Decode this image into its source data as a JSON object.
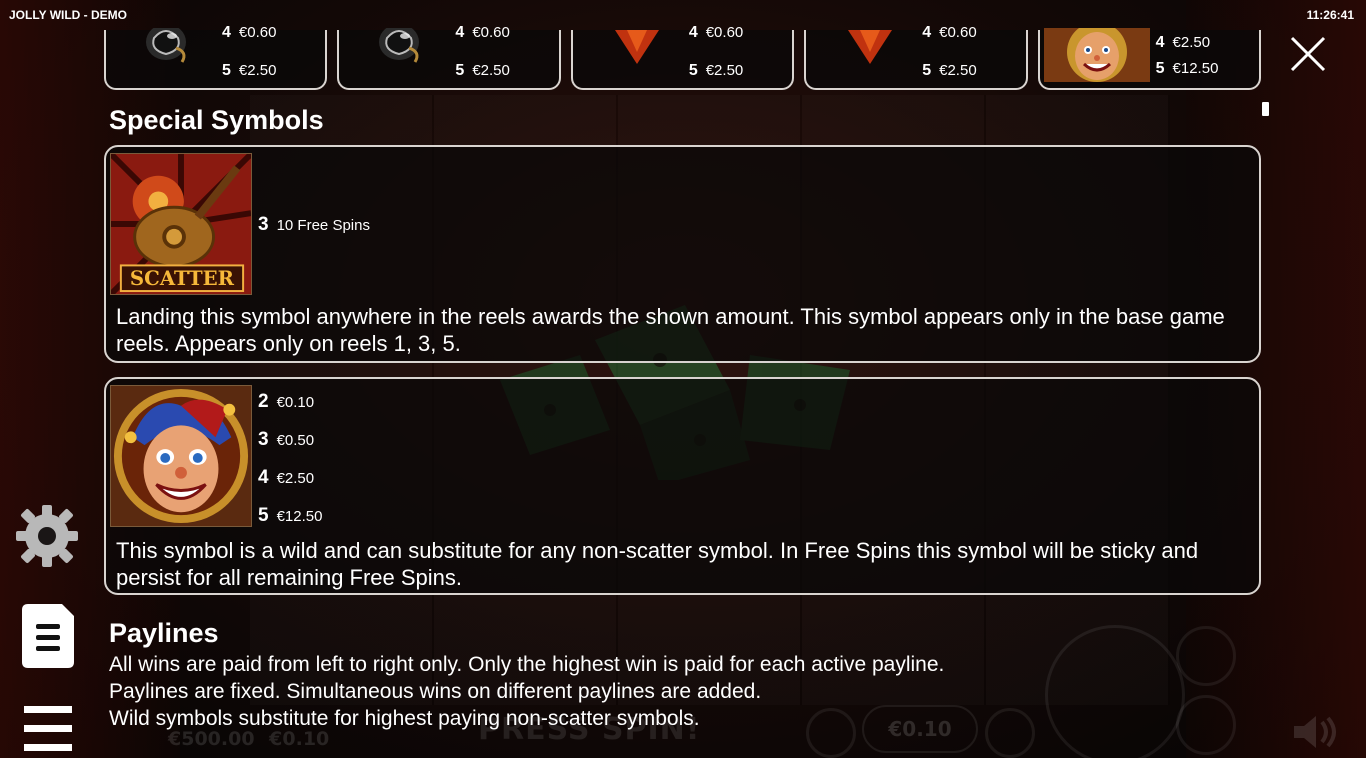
{
  "window": {
    "title": "JOLLY WILD - DEMO",
    "time": "11:26:41"
  },
  "paytable_top": [
    {
      "icon": "spade-symbol-icon",
      "line4": "4",
      "val4": "€0.60",
      "line5": "5",
      "val5": "€2.50"
    },
    {
      "icon": "spade-symbol-icon",
      "line4": "4",
      "val4": "€0.60",
      "line5": "5",
      "val5": "€2.50"
    },
    {
      "icon": "diamond-symbol-icon",
      "line4": "4",
      "val4": "€0.60",
      "line5": "5",
      "val5": "€2.50"
    },
    {
      "icon": "diamond-symbol-icon",
      "line4": "4",
      "val4": "€0.60",
      "line5": "5",
      "val5": "€2.50"
    },
    {
      "icon": "jester-symbol-icon",
      "line4": "4",
      "val4": "€2.50",
      "line5": "5",
      "val5": "€12.50"
    }
  ],
  "special": {
    "title": "Special Symbols",
    "scatter": {
      "label": "SCATTER",
      "count": "3",
      "reward": "10 Free Spins",
      "description": "Landing this symbol anywhere in the reels awards the shown amount. This symbol appears only in the base game reels. Appears only on reels 1, 3, 5."
    },
    "wild": {
      "pays": [
        {
          "count": "2",
          "value": "€0.10"
        },
        {
          "count": "3",
          "value": "€0.50"
        },
        {
          "count": "4",
          "value": "€2.50"
        },
        {
          "count": "5",
          "value": "€12.50"
        }
      ],
      "description": "This symbol is a wild and can substitute for any non-scatter symbol. In Free Spins this symbol will be sticky and persist for all remaining Free Spins."
    }
  },
  "paylines": {
    "title": "Paylines",
    "lines": [
      "All wins are paid from left to right only. Only the highest win is paid for each active payline.",
      "Paylines are fixed. Simultaneous wins on different paylines are added.",
      "Wild symbols substitute for highest paying non-scatter symbols."
    ]
  },
  "background": {
    "press_spin": "PRESS SPIN!",
    "balance": "€500.00",
    "bet": "€0.10",
    "stake": "€0.10"
  },
  "colors": {
    "border": "#d9d4d0",
    "panel": "#0a0808",
    "accent": "#ffffff"
  }
}
